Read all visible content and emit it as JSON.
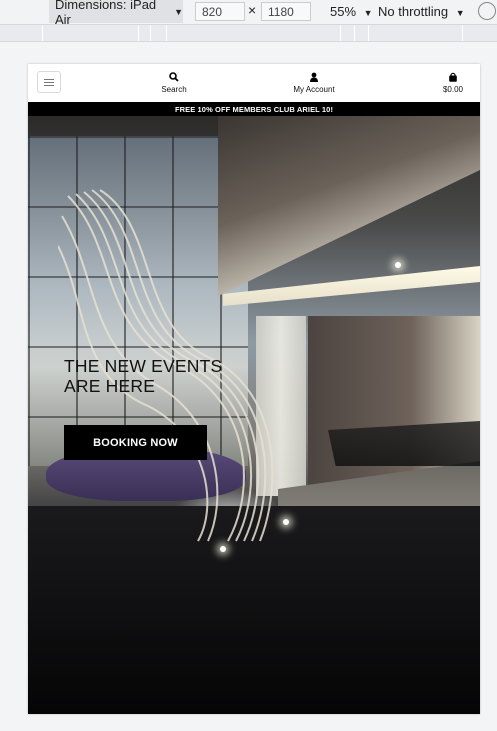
{
  "devtools": {
    "dimensions_label": "Dimensions: iPad Air",
    "width": "820",
    "times": "×",
    "height": "1180",
    "zoom": "55%",
    "throttling": "No throttling"
  },
  "header": {
    "search_label": "Search",
    "account_label": "My Account",
    "cart_total": "$0.00"
  },
  "promo": {
    "text": "FREE 10% OFF MEMBERS CLUB ARIEL 10!"
  },
  "hero": {
    "heading_line1": "THE NEW EVENTS",
    "heading_line2": "ARE HERE",
    "cta_label": "BOOKING NOW"
  }
}
